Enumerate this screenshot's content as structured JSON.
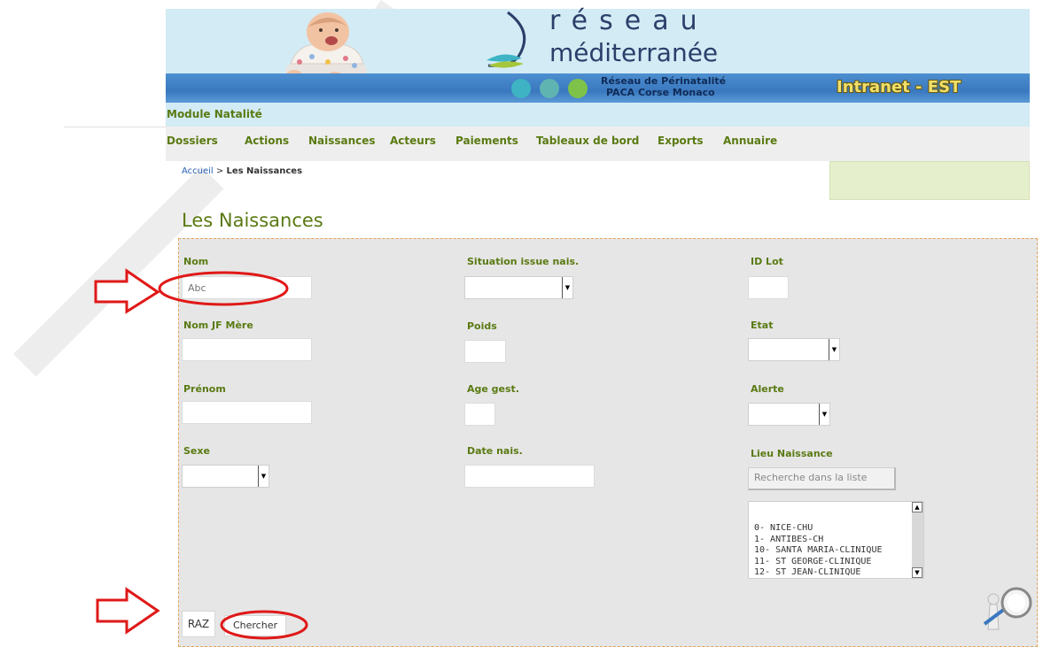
{
  "header": {
    "logo_line1": "réseau",
    "logo_line2": "méditerranée",
    "perinatal_line1": "Réseau de Périnatalité",
    "perinatal_line2": "PACA  Corse  Monaco",
    "intranet_label": "Intranet - EST",
    "module_label": "Module Natalité"
  },
  "menu": [
    {
      "label": "Dossiers"
    },
    {
      "label": "Actions"
    },
    {
      "label": "Naissances"
    },
    {
      "label": "Acteurs"
    },
    {
      "label": "Paiements"
    },
    {
      "label": "Tableaux de bord"
    },
    {
      "label": "Exports"
    },
    {
      "label": "Annuaire"
    }
  ],
  "breadcrumb": {
    "home": "Accueil",
    "sep": " > ",
    "current": "Les Naissances"
  },
  "page_title": "Les Naissances",
  "form": {
    "nom": {
      "label": "Nom",
      "placeholder": "Abc",
      "value": ""
    },
    "nom_jf_mere": {
      "label": "Nom JF Mère",
      "value": ""
    },
    "prenom": {
      "label": "Prénom",
      "value": ""
    },
    "sexe": {
      "label": "Sexe",
      "value": ""
    },
    "situation": {
      "label": "Situation issue nais.",
      "value": ""
    },
    "poids": {
      "label": "Poids",
      "value": ""
    },
    "age_gest": {
      "label": "Age gest.",
      "value": ""
    },
    "date_nais": {
      "label": "Date nais.",
      "value": ""
    },
    "id_lot": {
      "label": "ID Lot",
      "value": ""
    },
    "etat": {
      "label": "Etat",
      "value": ""
    },
    "alerte": {
      "label": "Alerte",
      "value": ""
    },
    "lieu_naissance": {
      "label": "Lieu Naissance",
      "search_placeholder": "Recherche dans la liste",
      "options": [
        "0- NICE-CHU",
        "1- ANTIBES-CH",
        "10- SANTA MARIA-CLINIQUE",
        "11- ST GEORGE-CLINIQUE",
        "12- ST JEAN-CLINIQUE"
      ]
    }
  },
  "buttons": {
    "raz": "RAZ",
    "chercher": "Chercher"
  },
  "colors": {
    "accent_green": "#5a7a12",
    "annotation_red": "#e01818",
    "header_blue": "#3a78bf",
    "banner_bg": "#d3ebf5"
  }
}
